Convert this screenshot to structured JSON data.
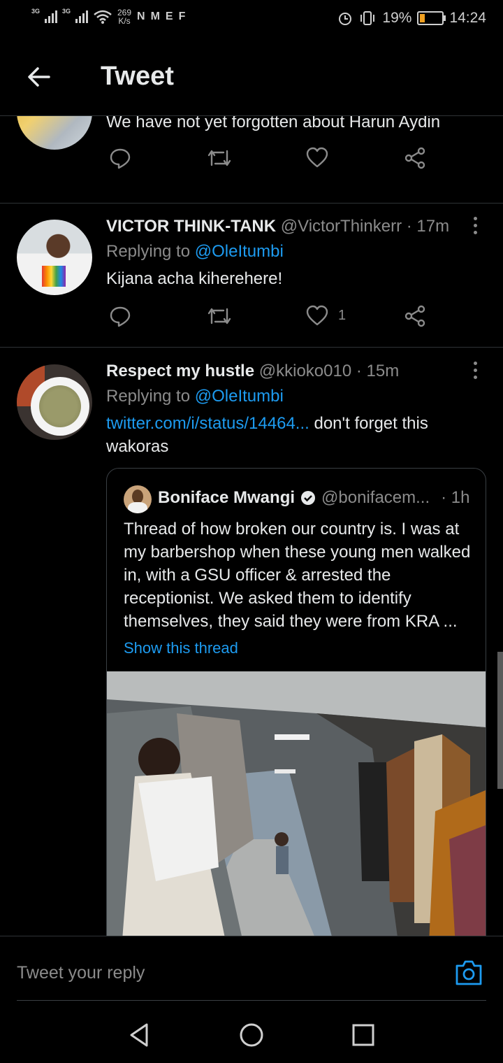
{
  "status_bar": {
    "network_1": "3G",
    "network_2": "3G",
    "speed_value": "269",
    "speed_unit": "K/s",
    "notif_icons": [
      "N",
      "M",
      "E",
      "F"
    ],
    "battery": "19%",
    "time": "14:24"
  },
  "header": {
    "title": "Tweet"
  },
  "tweets": [
    {
      "text": "We have not yet forgotten about Harun Aydin"
    },
    {
      "name": "VICTOR THINK-TANK",
      "handle": "@VictorThinkerr",
      "time": "· 17m",
      "replying_prefix": "Replying to ",
      "replying_handle": "@OleItumbi",
      "text": "Kijana acha kiherehere!",
      "like_count": "1"
    },
    {
      "name": "Respect my hustle",
      "handle": "@kkioko010",
      "time": "· 15m",
      "replying_prefix": "Replying to ",
      "replying_handle": "@OleItumbi",
      "link": "twitter.com/i/status/14464...",
      "text_after_link": " don't forget this wakoras",
      "quote": {
        "name": "Boniface Mwangi",
        "handle": "@bonifacem...",
        "time": "· 1h",
        "text": "Thread of how broken our country is. I was at my barbershop when these young men walked in, with a GSU officer & arrested the receptionist. We asked them to identify themselves, they said they were from KRA ...",
        "show_thread": "Show this thread"
      }
    }
  ],
  "composer": {
    "placeholder": "Tweet your reply"
  },
  "colors": {
    "accent": "#1d9bf0",
    "background": "#000000",
    "muted": "#8b8b8b"
  }
}
